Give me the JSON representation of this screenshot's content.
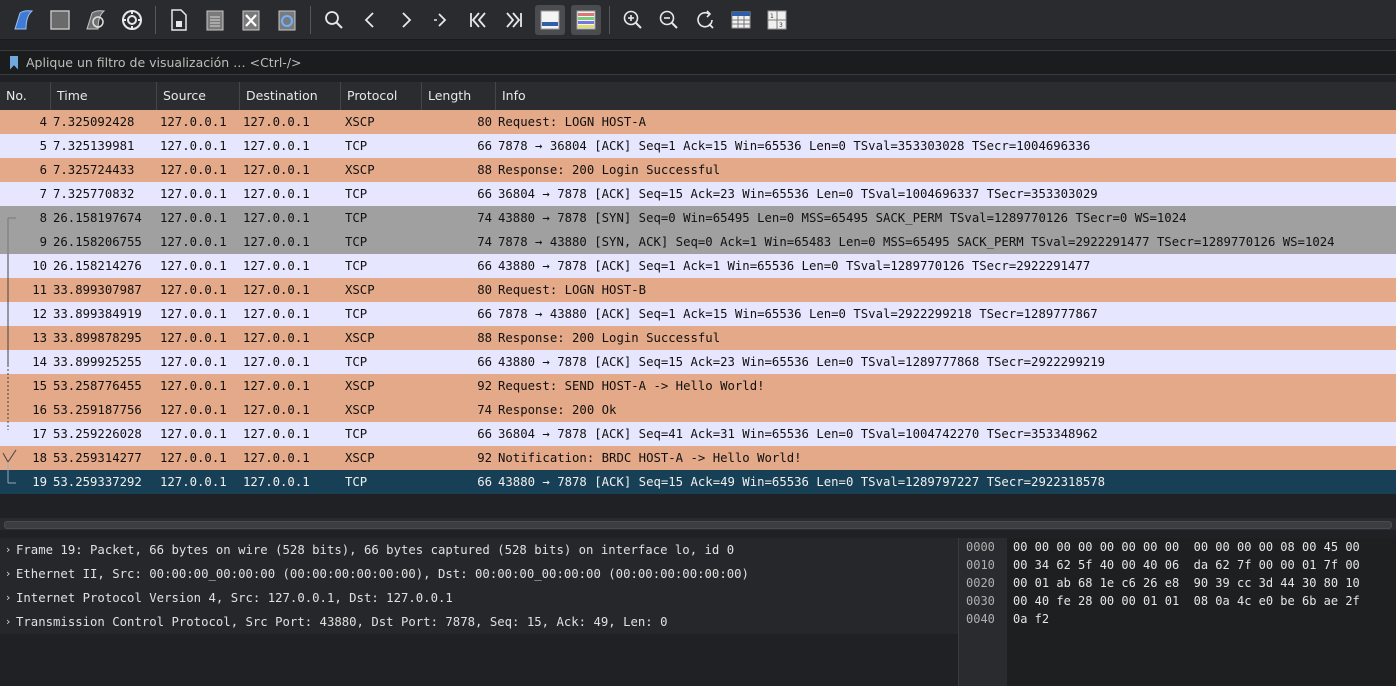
{
  "toolbar": {
    "buttons": [
      {
        "name": "start-capture-icon"
      },
      {
        "name": "stop-capture-icon"
      },
      {
        "name": "restart-capture-icon"
      },
      {
        "name": "capture-options-icon"
      },
      {
        "name": "open-file-icon"
      },
      {
        "name": "save-file-icon"
      },
      {
        "name": "close-file-icon"
      },
      {
        "name": "reload-file-icon"
      },
      {
        "name": "find-packet-icon"
      },
      {
        "name": "go-back-icon"
      },
      {
        "name": "go-forward-icon"
      },
      {
        "name": "go-to-packet-icon"
      },
      {
        "name": "go-first-packet-icon"
      },
      {
        "name": "go-last-packet-icon"
      },
      {
        "name": "auto-scroll-icon"
      },
      {
        "name": "colorize-icon"
      },
      {
        "name": "zoom-in-icon"
      },
      {
        "name": "zoom-out-icon"
      },
      {
        "name": "normal-size-icon"
      },
      {
        "name": "resize-columns-icon"
      }
    ]
  },
  "filter": {
    "placeholder": "Aplique un filtro de visualización … <Ctrl-/>"
  },
  "packet_list": {
    "columns": [
      "No.",
      "Time",
      "Source",
      "Destination",
      "Protocol",
      "Length",
      "Info"
    ],
    "rows": [
      {
        "no": "4",
        "time": "7.325092428",
        "src": "127.0.0.1",
        "dst": "127.0.0.1",
        "proto": "XSCP",
        "len": "80",
        "info": "Request: LOGN HOST-A",
        "style": "xscp"
      },
      {
        "no": "5",
        "time": "7.325139981",
        "src": "127.0.0.1",
        "dst": "127.0.0.1",
        "proto": "TCP",
        "len": "66",
        "info": "7878 → 36804 [ACK] Seq=1 Ack=15 Win=65536 Len=0 TSval=353303028 TSecr=1004696336",
        "style": "tcp"
      },
      {
        "no": "6",
        "time": "7.325724433",
        "src": "127.0.0.1",
        "dst": "127.0.0.1",
        "proto": "XSCP",
        "len": "88",
        "info": "Response: 200 Login Successful",
        "style": "xscp"
      },
      {
        "no": "7",
        "time": "7.325770832",
        "src": "127.0.0.1",
        "dst": "127.0.0.1",
        "proto": "TCP",
        "len": "66",
        "info": "36804 → 7878 [ACK] Seq=15 Ack=23 Win=65536 Len=0 TSval=1004696337 TSecr=353303029",
        "style": "tcp"
      },
      {
        "no": "8",
        "time": "26.158197674",
        "src": "127.0.0.1",
        "dst": "127.0.0.1",
        "proto": "TCP",
        "len": "74",
        "info": "43880 → 7878 [SYN] Seq=0 Win=65495 Len=0 MSS=65495 SACK_PERM TSval=1289770126 TSecr=0 WS=1024",
        "style": "syn"
      },
      {
        "no": "9",
        "time": "26.158206755",
        "src": "127.0.0.1",
        "dst": "127.0.0.1",
        "proto": "TCP",
        "len": "74",
        "info": "7878 → 43880 [SYN, ACK] Seq=0 Ack=1 Win=65483 Len=0 MSS=65495 SACK_PERM TSval=2922291477 TSecr=1289770126 WS=1024",
        "style": "syn"
      },
      {
        "no": "10",
        "time": "26.158214276",
        "src": "127.0.0.1",
        "dst": "127.0.0.1",
        "proto": "TCP",
        "len": "66",
        "info": "43880 → 7878 [ACK] Seq=1 Ack=1 Win=65536 Len=0 TSval=1289770126 TSecr=2922291477",
        "style": "tcp"
      },
      {
        "no": "11",
        "time": "33.899307987",
        "src": "127.0.0.1",
        "dst": "127.0.0.1",
        "proto": "XSCP",
        "len": "80",
        "info": "Request: LOGN HOST-B",
        "style": "xscp"
      },
      {
        "no": "12",
        "time": "33.899384919",
        "src": "127.0.0.1",
        "dst": "127.0.0.1",
        "proto": "TCP",
        "len": "66",
        "info": "7878 → 43880 [ACK] Seq=1 Ack=15 Win=65536 Len=0 TSval=2922299218 TSecr=1289777867",
        "style": "tcp"
      },
      {
        "no": "13",
        "time": "33.899878295",
        "src": "127.0.0.1",
        "dst": "127.0.0.1",
        "proto": "XSCP",
        "len": "88",
        "info": "Response: 200 Login Successful",
        "style": "xscp"
      },
      {
        "no": "14",
        "time": "33.899925255",
        "src": "127.0.0.1",
        "dst": "127.0.0.1",
        "proto": "TCP",
        "len": "66",
        "info": "43880 → 7878 [ACK] Seq=15 Ack=23 Win=65536 Len=0 TSval=1289777868 TSecr=2922299219",
        "style": "tcp"
      },
      {
        "no": "15",
        "time": "53.258776455",
        "src": "127.0.0.1",
        "dst": "127.0.0.1",
        "proto": "XSCP",
        "len": "92",
        "info": "Request: SEND HOST-A -> Hello World!",
        "style": "xscp"
      },
      {
        "no": "16",
        "time": "53.259187756",
        "src": "127.0.0.1",
        "dst": "127.0.0.1",
        "proto": "XSCP",
        "len": "74",
        "info": "Response: 200 Ok",
        "style": "xscp"
      },
      {
        "no": "17",
        "time": "53.259226028",
        "src": "127.0.0.1",
        "dst": "127.0.0.1",
        "proto": "TCP",
        "len": "66",
        "info": "36804 → 7878 [ACK] Seq=41 Ack=31 Win=65536 Len=0 TSval=1004742270 TSecr=353348962",
        "style": "tcp"
      },
      {
        "no": "18",
        "time": "53.259314277",
        "src": "127.0.0.1",
        "dst": "127.0.0.1",
        "proto": "XSCP",
        "len": "92",
        "info": "Notification: BRDC HOST-A -> Hello World!",
        "style": "xscp"
      },
      {
        "no": "19",
        "time": "53.259337292",
        "src": "127.0.0.1",
        "dst": "127.0.0.1",
        "proto": "TCP",
        "len": "66",
        "info": "43880 → 7878 [ACK] Seq=15 Ack=49 Win=65536 Len=0 TSval=1289797227 TSecr=2922318578",
        "style": "selected"
      }
    ]
  },
  "details": {
    "items": [
      "Frame 19: Packet, 66 bytes on wire (528 bits), 66 bytes captured (528 bits) on interface lo, id 0",
      "Ethernet II, Src: 00:00:00_00:00:00 (00:00:00:00:00:00), Dst: 00:00:00_00:00:00 (00:00:00:00:00:00)",
      "Internet Protocol Version 4, Src: 127.0.0.1, Dst: 127.0.0.1",
      "Transmission Control Protocol, Src Port: 43880, Dst Port: 7878, Seq: 15, Ack: 49, Len: 0"
    ]
  },
  "bytes": {
    "offsets": [
      "0000",
      "0010",
      "0020",
      "0030",
      "0040"
    ],
    "hex": [
      "00 00 00 00 00 00 00 00  00 00 00 00 08 00 45 00",
      "00 34 62 5f 40 00 40 06  da 62 7f 00 00 01 7f 00",
      "00 01 ab 68 1e c6 26 e8  90 39 cc 3d 44 30 80 10",
      "00 40 fe 28 00 00 01 01  08 0a 4c e0 be 6b ae 2f",
      "0a f2"
    ]
  }
}
